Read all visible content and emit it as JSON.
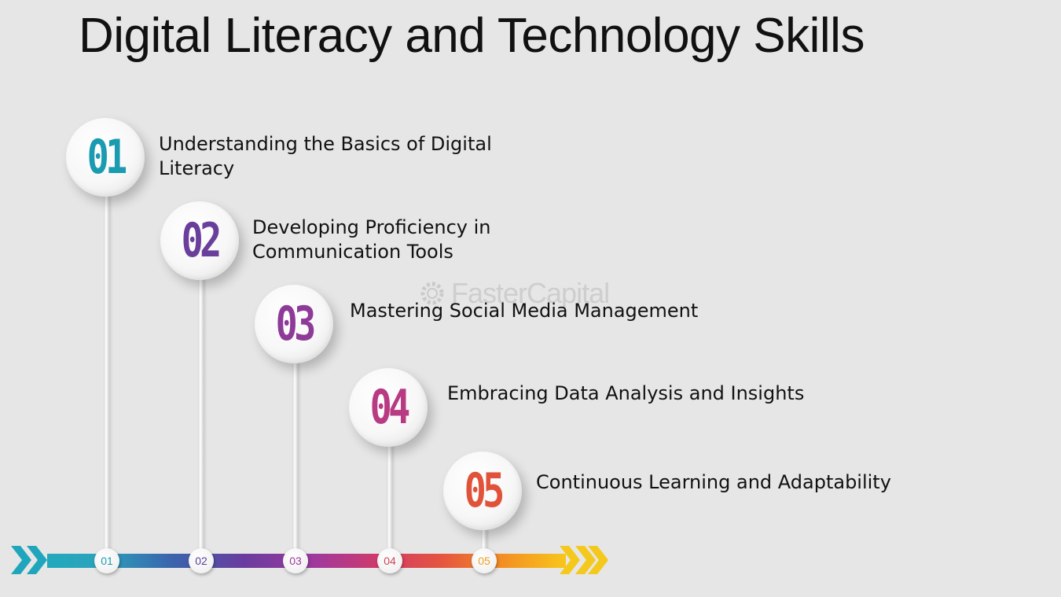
{
  "title": "Digital Literacy and Technology Skills",
  "watermark": "FasterCapital",
  "steps": [
    {
      "num": "01",
      "label": "Understanding the Basics of Digital Literacy",
      "color": "#1b9bb0"
    },
    {
      "num": "02",
      "label": "Developing Proficiency in Communication Tools",
      "color": "#6a3f9c"
    },
    {
      "num": "03",
      "label": "Mastering Social Media Management",
      "color": "#8e3a99"
    },
    {
      "num": "04",
      "label": "Embracing Data Analysis and Insights",
      "color": "#b83a82"
    },
    {
      "num": "05",
      "label": "Continuous Learning and Adaptability",
      "color": "#e0533a"
    }
  ],
  "markers": [
    {
      "label": "01",
      "color": "#1b9bb0"
    },
    {
      "label": "02",
      "color": "#5a3f9c"
    },
    {
      "label": "03",
      "color": "#9a3a99"
    },
    {
      "label": "04",
      "color": "#d0445a"
    },
    {
      "label": "05",
      "color": "#f0a020"
    }
  ],
  "icons": {
    "start": "chevron-right-icon",
    "end": "chevron-right-icon"
  }
}
